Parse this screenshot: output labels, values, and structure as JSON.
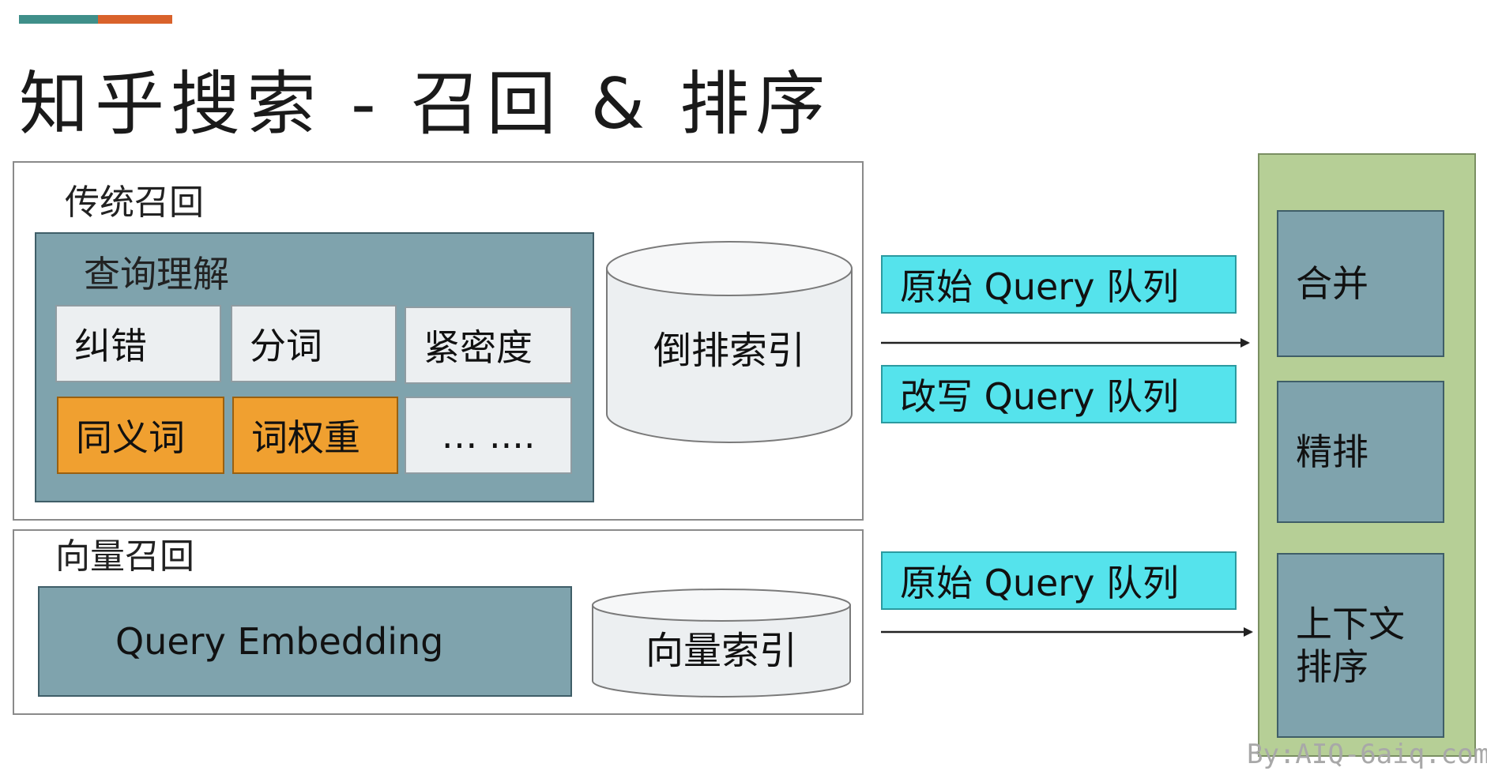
{
  "title": "知乎搜索 - 召回 & 排序",
  "colors": {
    "accent_teal": "#3f8f8a",
    "accent_orange": "#d9622b",
    "slate": "#7fa3ad",
    "orange": "#f0a030",
    "cyan": "#55e3ec",
    "green": "#b6cf96"
  },
  "traditional": {
    "label": "传统召回",
    "query_understanding": {
      "label": "查询理解",
      "cells": [
        "纠错",
        "分词",
        "紧密度",
        "同义词",
        "词权重",
        "… ...."
      ]
    },
    "index_label": "倒排索引"
  },
  "vector": {
    "label": "向量召回",
    "embedding_label": "Query Embedding",
    "index_label": "向量索引"
  },
  "queues": {
    "original_1": "原始 Query 队列",
    "rewrite": "改写 Query 队列",
    "original_2": "原始 Query 队列"
  },
  "ranking": {
    "merge": "合并",
    "fine_rank": "精排",
    "context_rank_line1": "上下文",
    "context_rank_line2": "排序"
  },
  "watermark": "By:AIQ-6aiq.com"
}
